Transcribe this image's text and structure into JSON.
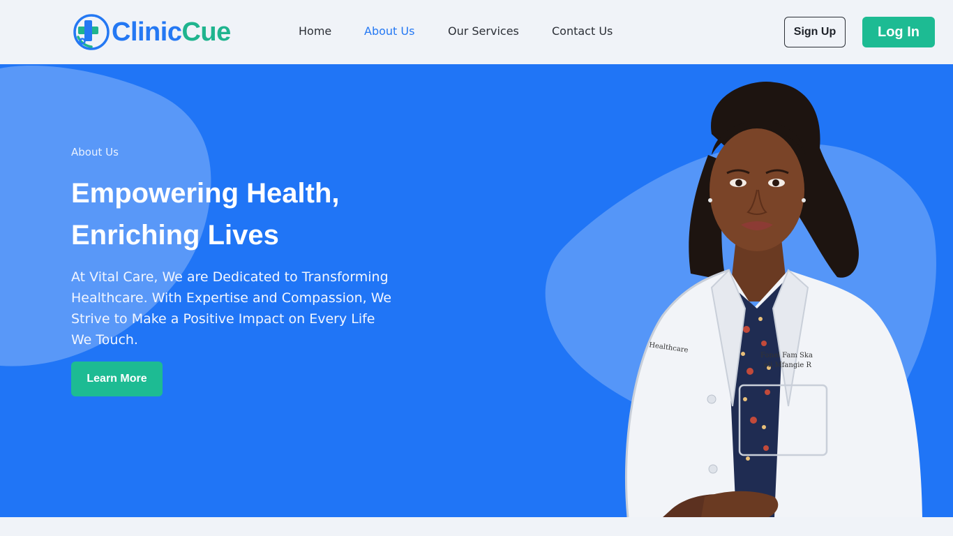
{
  "brand": {
    "name_part1": "Clinic",
    "name_part2": "Cue",
    "icon": "medical-cross-stethoscope-icon",
    "colors": {
      "blue": "#2478f3",
      "green": "#1fb48e"
    }
  },
  "nav": {
    "items": [
      {
        "label": "Home",
        "active": false
      },
      {
        "label": "About Us",
        "active": true
      },
      {
        "label": "Our Services",
        "active": false
      },
      {
        "label": "Contact Us",
        "active": false
      }
    ]
  },
  "auth": {
    "signup_label": "Sign Up",
    "login_label": "Log In"
  },
  "hero": {
    "eyebrow": "About Us",
    "headline_line1": "Empowering Health,",
    "headline_line2": "Enriching Lives",
    "lead": "At Vital Care, We are Dedicated to Transforming Healthcare. With Expertise and Compassion, We Strive to Make a Positive Impact on Every Life We Touch.",
    "cta_label": "Learn More",
    "background_color": "#2075f6",
    "accent_color": "#1dbb93",
    "image": "doctor-portrait-photo"
  }
}
